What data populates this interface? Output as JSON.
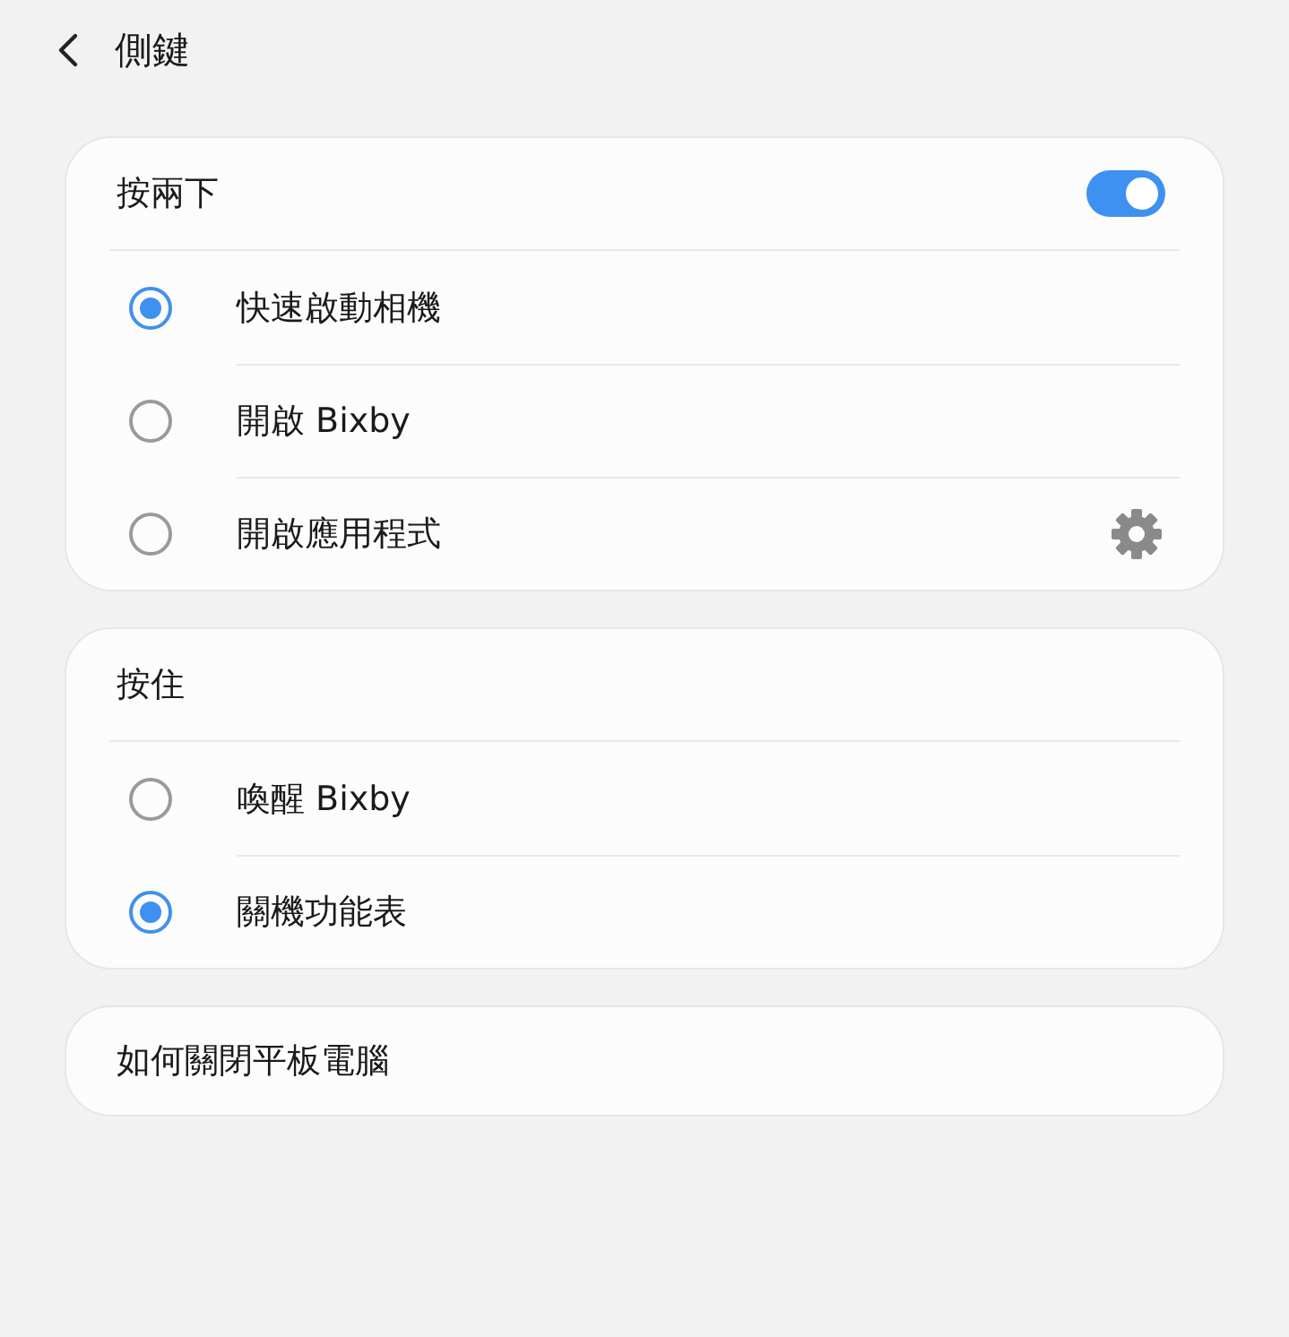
{
  "header": {
    "title": "側鍵"
  },
  "groups": [
    {
      "title": "按兩下",
      "toggle": {
        "on": true
      },
      "options": [
        {
          "label": "快速啟動相機",
          "selected": true
        },
        {
          "label": "開啟 Bixby",
          "selected": false
        },
        {
          "label": "開啟應用程式",
          "selected": false,
          "has_settings": true
        }
      ]
    },
    {
      "title": "按住",
      "options": [
        {
          "label": "喚醒 Bixby",
          "selected": false
        },
        {
          "label": "關機功能表",
          "selected": true
        }
      ]
    }
  ],
  "link": {
    "label": "如何關閉平板電腦"
  }
}
